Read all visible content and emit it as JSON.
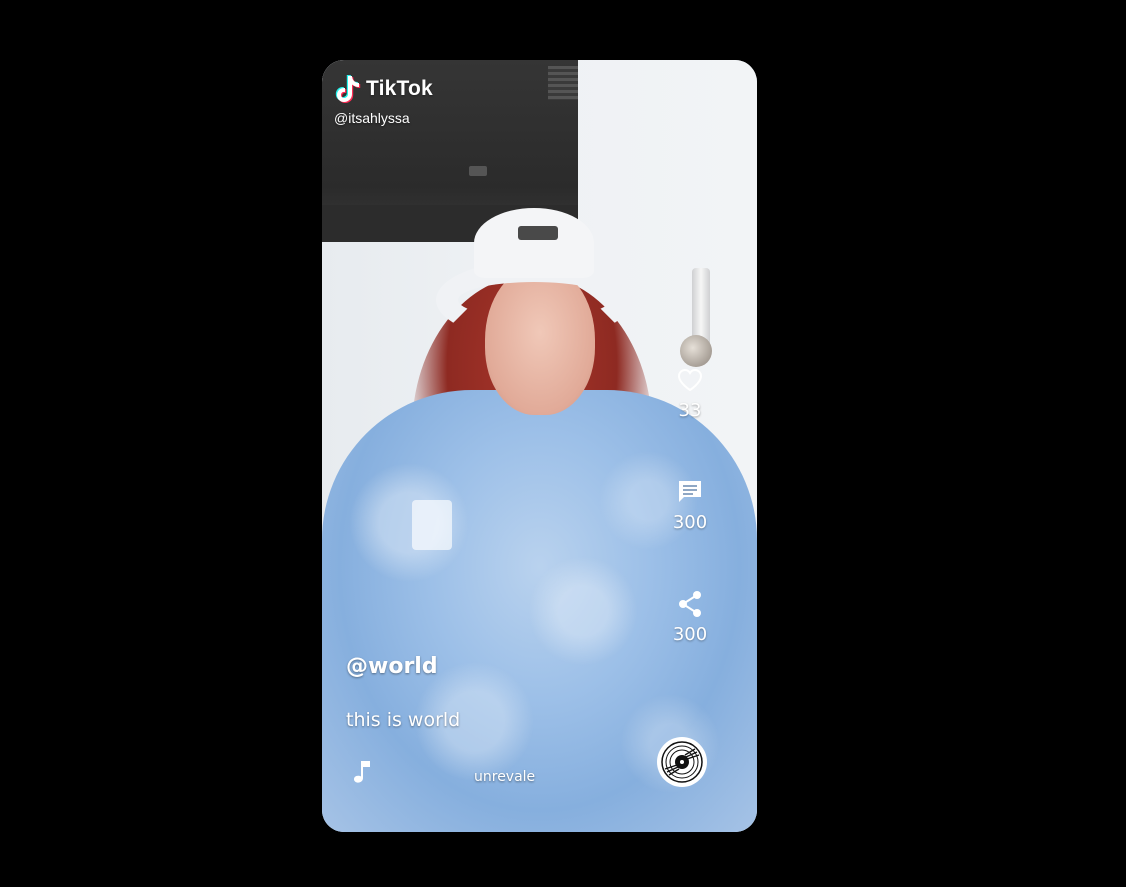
{
  "header": {
    "brand_name": "TikTok",
    "handle": "@itsahlyssa",
    "brand_icon": "tiktok-logo-icon"
  },
  "actions": [
    {
      "icon": "heart-icon",
      "count": "33"
    },
    {
      "icon": "comment-icon",
      "count": "300"
    },
    {
      "icon": "share-icon",
      "count": "300"
    }
  ],
  "caption": {
    "user": "@world",
    "text": "this is world"
  },
  "music": {
    "icon": "music-note-icon",
    "title": "unrevale",
    "record_icon": "vinyl-record-icon"
  },
  "colors": {
    "background": "#000000",
    "text": "#ffffff"
  }
}
